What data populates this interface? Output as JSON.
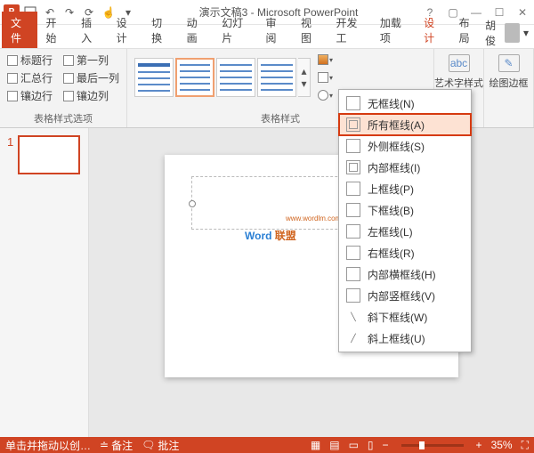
{
  "title": "演示文稿3 - Microsoft PowerPoint",
  "tabs": {
    "file": "文件",
    "start": "开始",
    "insert": "插入",
    "design_cn": "设计",
    "trans": "切换",
    "anim": "动画",
    "slideshow": "幻灯片",
    "review": "审阅",
    "view": "视图",
    "dev": "开发工",
    "addins": "加载项",
    "design": "设计",
    "layout": "布局"
  },
  "user": "胡俊",
  "table_opts": {
    "r1c1": "标题行",
    "r1c2": "第一列",
    "r2c1": "汇总行",
    "r2c2": "最后一列",
    "r3c1": "镶边行",
    "r3c2": "镶边列",
    "group": "表格样式选项"
  },
  "styles_group": "表格样式",
  "wordart": "艺术字样式",
  "drawborder": "绘图边框",
  "borders_menu": {
    "none": "无框线(N)",
    "all": "所有框线(A)",
    "outside": "外侧框线(S)",
    "inside": "内部框线(I)",
    "top": "上框线(P)",
    "bottom": "下框线(B)",
    "left": "左框线(L)",
    "right": "右框线(R)",
    "insideH": "内部横框线(H)",
    "insideV": "内部竖框线(V)",
    "diagDown": "斜下框线(W)",
    "diagUp": "斜上框线(U)"
  },
  "thumb_num": "1",
  "watermark": {
    "w1": "Word",
    "w2": " 联盟",
    "small": "www.wordlm.com"
  },
  "status": {
    "drag": "单击并拖动以创…",
    "notes": "备注",
    "comments": "批注",
    "zoom": "35%"
  }
}
